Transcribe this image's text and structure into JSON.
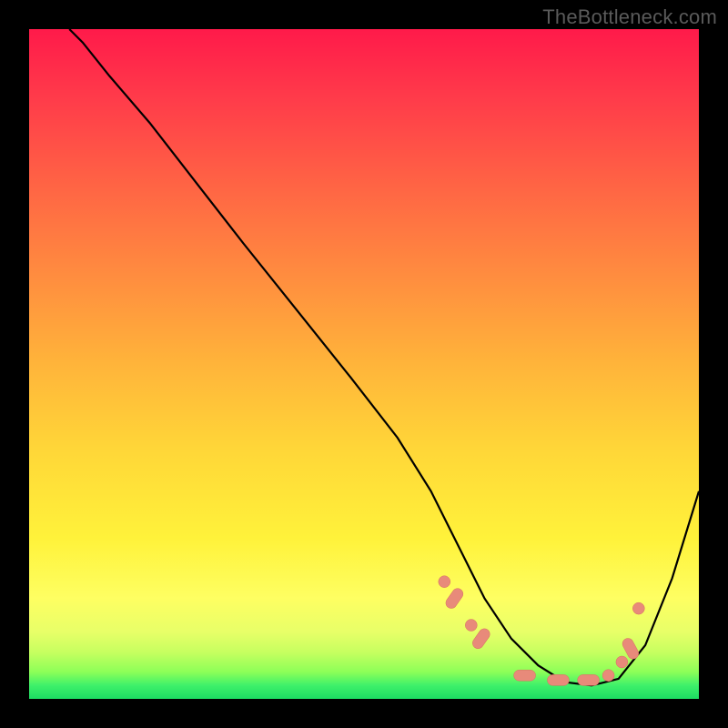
{
  "watermark": "TheBottleneck.com",
  "chart_data": {
    "type": "line",
    "title": "",
    "xlabel": "",
    "ylabel": "",
    "xlim": [
      0,
      100
    ],
    "ylim": [
      0,
      100
    ],
    "legend": false,
    "grid": false,
    "background": "red-to-green-vertical-gradient",
    "series": [
      {
        "name": "curve",
        "x": [
          6,
          8,
          12,
          18,
          25,
          32,
          40,
          48,
          55,
          60,
          63,
          65,
          68,
          72,
          76,
          80,
          84,
          88,
          92,
          96,
          100
        ],
        "y": [
          100,
          98,
          93,
          86,
          77,
          68,
          58,
          48,
          39,
          31,
          25,
          21,
          15,
          9,
          5,
          2.5,
          2,
          3,
          8,
          18,
          31
        ]
      }
    ],
    "markers": [
      {
        "shape": "dot",
        "x": 62.0,
        "y": 17.5
      },
      {
        "shape": "pill",
        "x": 63.5,
        "y": 15.0,
        "angle": -55
      },
      {
        "shape": "dot",
        "x": 66.0,
        "y": 11.0
      },
      {
        "shape": "pill",
        "x": 67.5,
        "y": 9.0,
        "angle": -55
      },
      {
        "shape": "pill",
        "x": 74.0,
        "y": 3.5,
        "angle": 0
      },
      {
        "shape": "pill",
        "x": 79.0,
        "y": 2.8,
        "angle": 0
      },
      {
        "shape": "pill",
        "x": 83.5,
        "y": 2.8,
        "angle": 0
      },
      {
        "shape": "dot",
        "x": 86.5,
        "y": 3.5
      },
      {
        "shape": "dot",
        "x": 88.5,
        "y": 5.5
      },
      {
        "shape": "pill",
        "x": 89.8,
        "y": 7.5,
        "angle": 62
      },
      {
        "shape": "dot",
        "x": 91.0,
        "y": 13.5
      }
    ]
  }
}
